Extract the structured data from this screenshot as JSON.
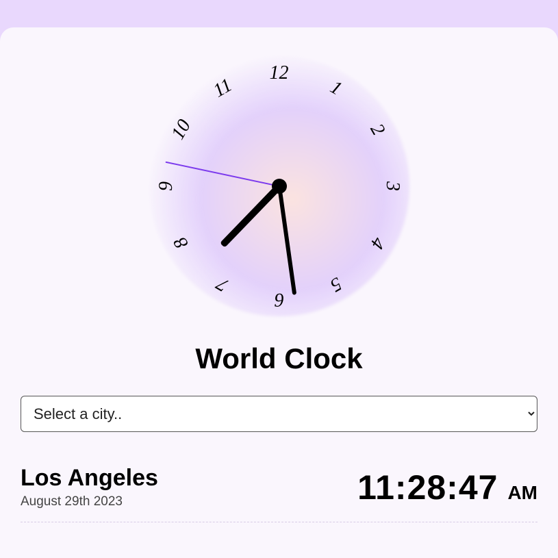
{
  "title": "World Clock",
  "select_placeholder": "Select a city..",
  "city": "Los Angeles",
  "date": "August 29th 2023",
  "time": "11:28:47",
  "ampm": "AM",
  "clock": {
    "hours": 11,
    "minutes": 28,
    "seconds": 47,
    "hour_angle": 224,
    "minute_angle": 172,
    "second_angle": 282
  },
  "numerals": [
    "12",
    "1",
    "2",
    "3",
    "4",
    "5",
    "6",
    "7",
    "8",
    "9",
    "10",
    "11"
  ]
}
